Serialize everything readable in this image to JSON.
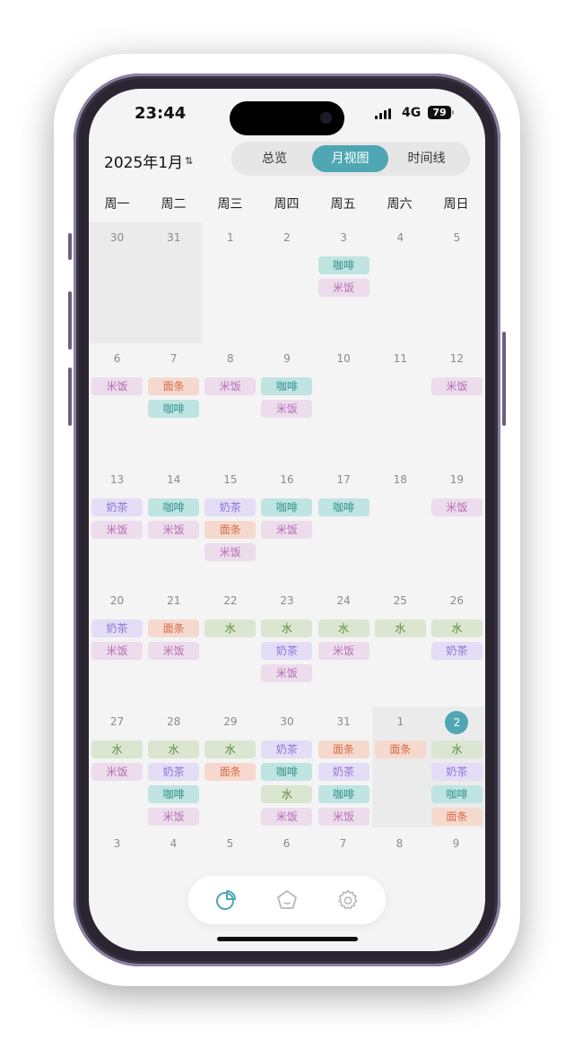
{
  "status": {
    "time": "23:44",
    "network": "4G",
    "battery": "79"
  },
  "header": {
    "month_title": "2025年1月",
    "tabs": [
      {
        "label": "总览",
        "active": false
      },
      {
        "label": "月视图",
        "active": true
      },
      {
        "label": "时间线",
        "active": false
      }
    ]
  },
  "weekdays": [
    "周一",
    "周二",
    "周三",
    "周四",
    "周五",
    "周六",
    "周日"
  ],
  "weeks": [
    [
      {
        "day": "30",
        "tags": []
      },
      {
        "day": "31",
        "tags": []
      },
      {
        "day": "1",
        "tags": []
      },
      {
        "day": "2",
        "tags": []
      },
      {
        "day": "3",
        "tags": [
          "咖啡",
          "米饭"
        ]
      },
      {
        "day": "4",
        "tags": []
      },
      {
        "day": "5",
        "tags": []
      }
    ],
    [
      {
        "day": "6",
        "tags": [
          "米饭"
        ]
      },
      {
        "day": "7",
        "tags": [
          "面条",
          "咖啡"
        ]
      },
      {
        "day": "8",
        "tags": [
          "米饭"
        ]
      },
      {
        "day": "9",
        "tags": [
          "咖啡",
          "米饭"
        ]
      },
      {
        "day": "10",
        "tags": []
      },
      {
        "day": "11",
        "tags": []
      },
      {
        "day": "12",
        "tags": [
          "米饭"
        ]
      }
    ],
    [
      {
        "day": "13",
        "tags": [
          "奶茶",
          "米饭"
        ]
      },
      {
        "day": "14",
        "tags": [
          "咖啡",
          "米饭"
        ]
      },
      {
        "day": "15",
        "tags": [
          "奶茶",
          "面条",
          "米饭"
        ]
      },
      {
        "day": "16",
        "tags": [
          "咖啡",
          "米饭"
        ]
      },
      {
        "day": "17",
        "tags": [
          "咖啡"
        ]
      },
      {
        "day": "18",
        "tags": []
      },
      {
        "day": "19",
        "tags": [
          "米饭"
        ]
      }
    ],
    [
      {
        "day": "20",
        "tags": [
          "奶茶",
          "米饭"
        ]
      },
      {
        "day": "21",
        "tags": [
          "面条",
          "米饭"
        ]
      },
      {
        "day": "22",
        "tags": [
          "水"
        ]
      },
      {
        "day": "23",
        "tags": [
          "水",
          "奶茶",
          "米饭"
        ]
      },
      {
        "day": "24",
        "tags": [
          "水",
          "米饭"
        ]
      },
      {
        "day": "25",
        "tags": [
          "水"
        ]
      },
      {
        "day": "26",
        "tags": [
          "水",
          "奶茶"
        ]
      }
    ],
    [
      {
        "day": "27",
        "tags": [
          "水",
          "米饭"
        ]
      },
      {
        "day": "28",
        "tags": [
          "水",
          "奶茶",
          "咖啡",
          "米饭"
        ]
      },
      {
        "day": "29",
        "tags": [
          "水",
          "面条"
        ]
      },
      {
        "day": "30",
        "tags": [
          "奶茶",
          "咖啡",
          "水",
          "米饭"
        ]
      },
      {
        "day": "31",
        "tags": [
          "面条",
          "奶茶",
          "咖啡",
          "米饭"
        ]
      },
      {
        "day": "1",
        "tags": [
          "面条"
        ]
      },
      {
        "day": "2",
        "tags": [
          "水",
          "奶茶",
          "咖啡",
          "面条"
        ],
        "today": true
      }
    ]
  ],
  "trailing_days": [
    "3",
    "4",
    "5",
    "6",
    "7",
    "8",
    "9"
  ],
  "tag_colors": {
    "咖啡": "#bfe4e2",
    "米饭": "#ecdcec",
    "面条": "#f6d9ce",
    "奶茶": "#e3ddf6",
    "水": "#dbe6d1"
  },
  "accent": "#4fa7b4",
  "tabbar": {
    "icons": [
      "chart-pie-icon",
      "pentagon-face-icon",
      "gear-icon"
    ]
  }
}
